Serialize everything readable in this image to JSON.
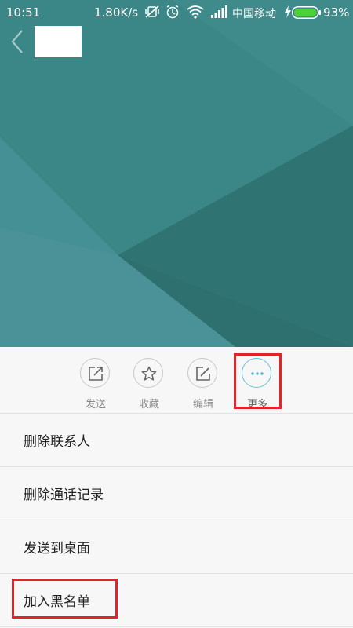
{
  "status_bar": {
    "time": "10:51",
    "speed": "1.80K/s",
    "carrier": "中国移动",
    "battery": "93%",
    "icons": [
      "mute-vibrate-icon",
      "alarm-icon",
      "wifi-icon",
      "signal-icon",
      "charging-icon",
      "battery-icon"
    ]
  },
  "contact": {
    "name": ""
  },
  "actions": [
    {
      "label": "发送",
      "icon": "share-icon"
    },
    {
      "label": "收藏",
      "icon": "star-icon"
    },
    {
      "label": "编辑",
      "icon": "edit-icon"
    },
    {
      "label": "更多",
      "icon": "more-icon"
    }
  ],
  "menu": [
    {
      "label": "删除联系人"
    },
    {
      "label": "删除通话记录"
    },
    {
      "label": "发送到桌面"
    },
    {
      "label": "加入黑名单"
    }
  ],
  "colors": {
    "header": "#3a8585",
    "highlight": "#e0242a",
    "more_accent": "#66c3cc",
    "battery": "#4cd137"
  }
}
